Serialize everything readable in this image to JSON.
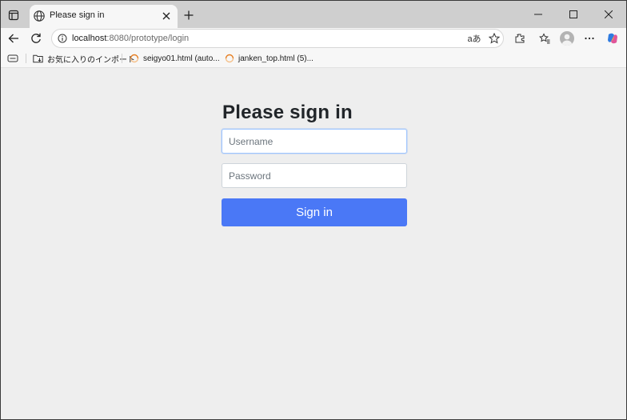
{
  "browser": {
    "tab": {
      "title": "Please sign in"
    },
    "address": {
      "host": "localhost",
      "path": ":8080/prototype/login"
    },
    "read_aloud_glyph": "aあ",
    "bookmarks": [
      {
        "label": "お気に入りのインポート",
        "icon": "folder-import-icon"
      },
      {
        "label": "seigyo01.html (auto...",
        "icon": "loading-favicon-icon"
      },
      {
        "label": "janken_top.html (5)...",
        "icon": "loading-favicon-icon"
      }
    ]
  },
  "form": {
    "heading": "Please sign in",
    "username_placeholder": "Username",
    "password_placeholder": "Password",
    "submit_label": "Sign in"
  },
  "colors": {
    "primary_button": "#4a78f6",
    "page_background": "#eeeeee",
    "tabstrip_background": "#cfcfcf"
  }
}
